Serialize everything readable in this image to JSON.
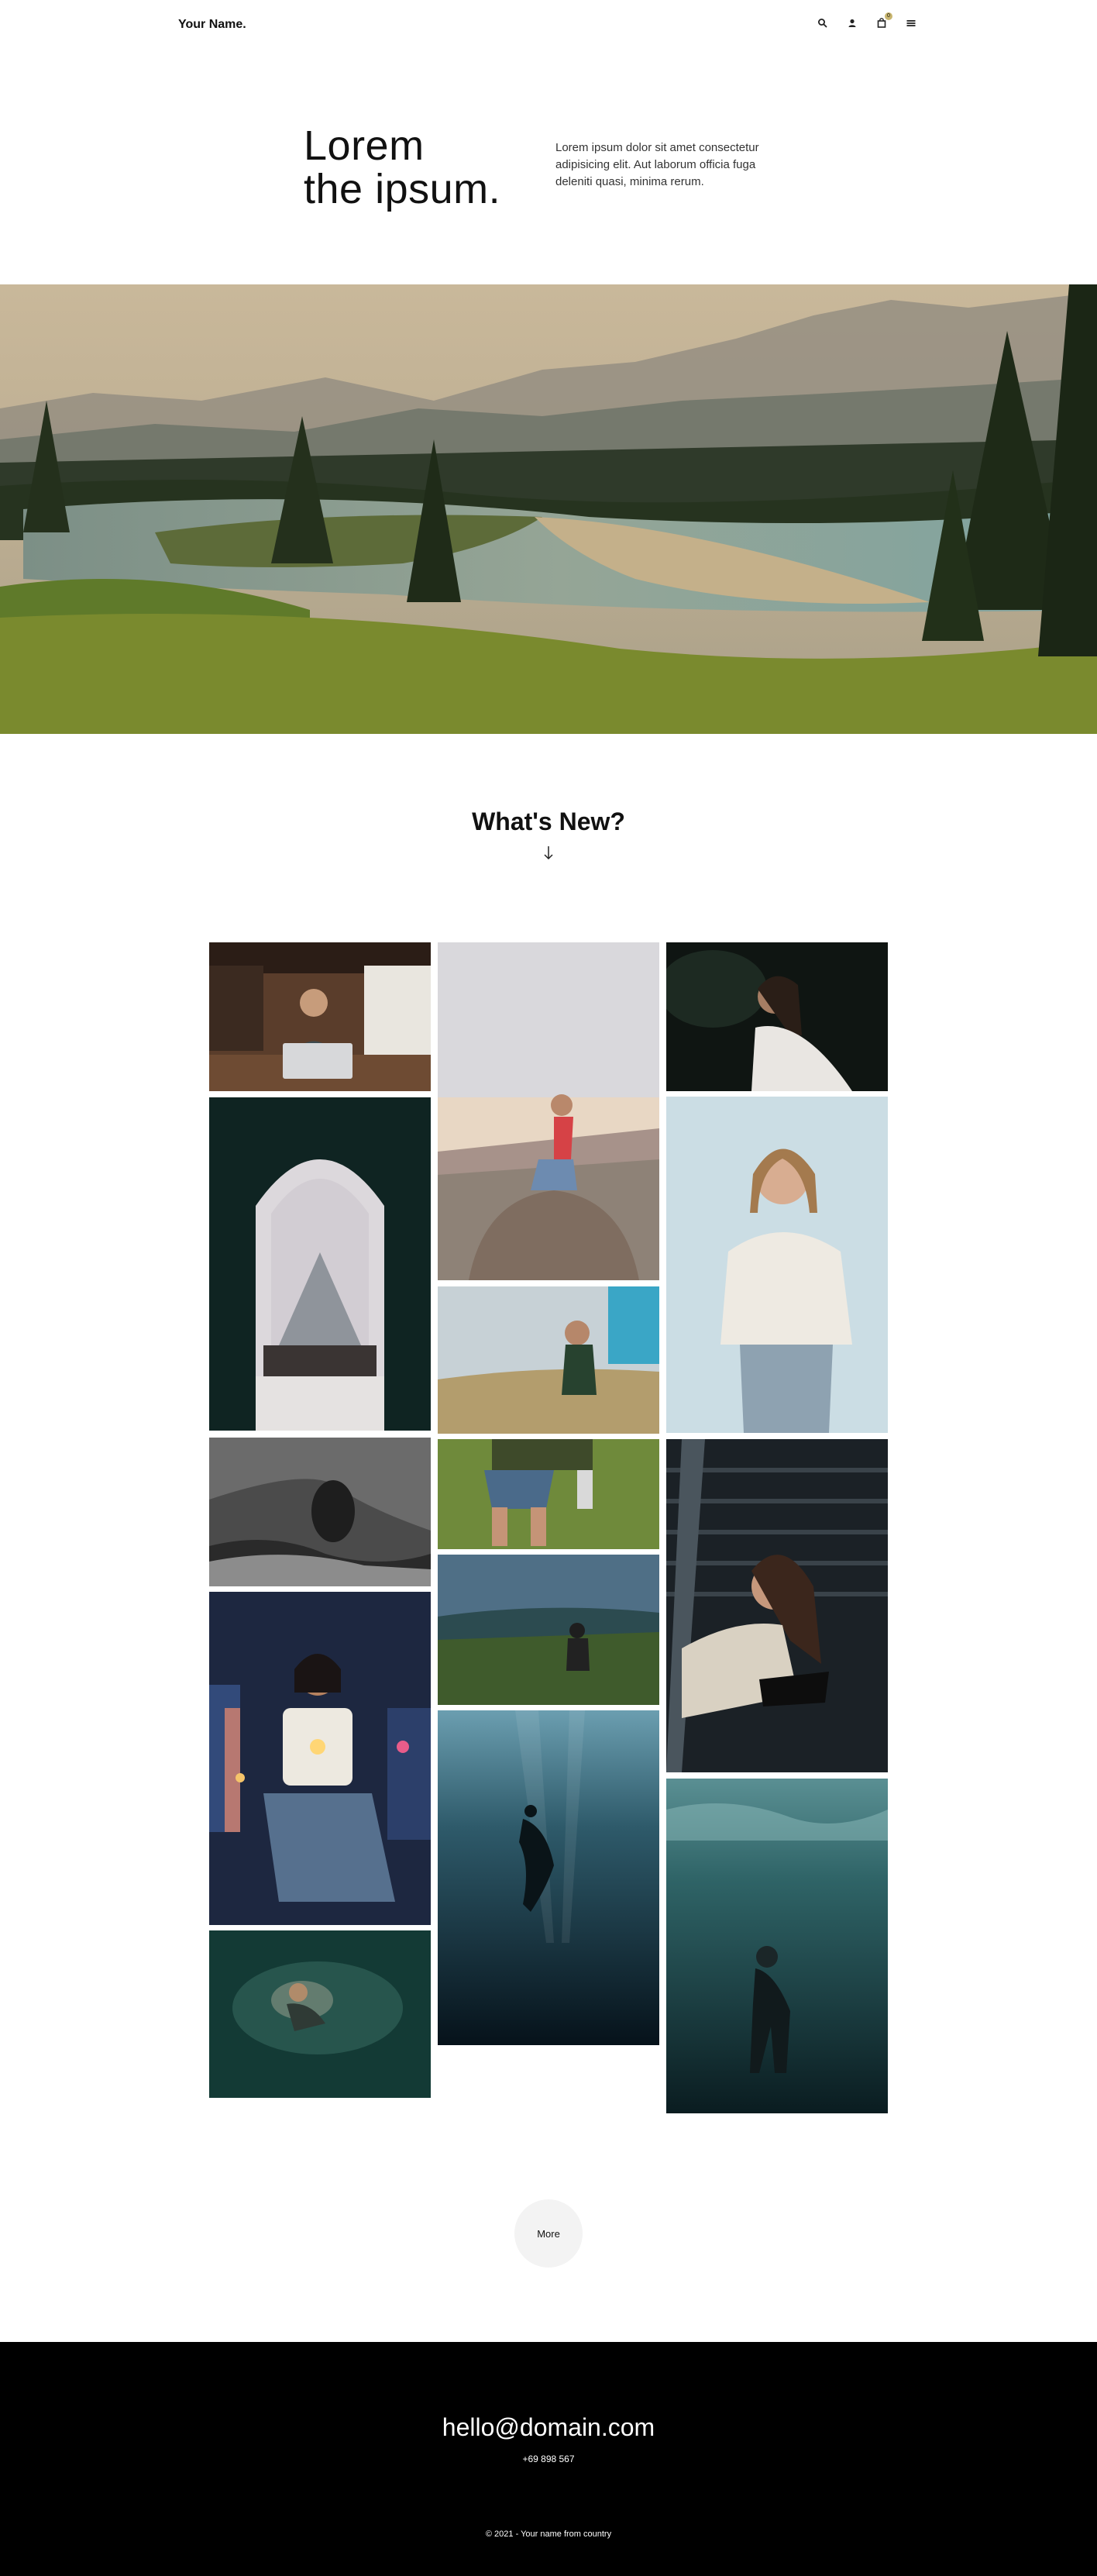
{
  "header": {
    "logo": "Your Name.",
    "icons": [
      "search-icon",
      "user-icon",
      "cart-icon",
      "menu-icon"
    ],
    "cart_count": "0"
  },
  "hero": {
    "title_line1": "Lorem",
    "title_line2": "the ipsum.",
    "description": "Lorem ipsum dolor sit amet consectetur adipisicing elit. Aut laborum officia fuga deleniti quasi, minima rerum."
  },
  "banner": {
    "subject": "mountain-lake-landscape"
  },
  "whats_new": {
    "title": "What's New?",
    "arrow_icon": "arrow-down-icon"
  },
  "gallery": [
    {
      "subject": "man-with-laptop-cafe"
    },
    {
      "subject": "woman-sitting-on-rock-sunset"
    },
    {
      "subject": "woman-dark-portrait"
    },
    {
      "subject": "louvre-pyramid-archway"
    },
    {
      "subject": "woman-with-glasses-sweater"
    },
    {
      "subject": "woman-in-wheat-field"
    },
    {
      "subject": "rock-arch-black-white"
    },
    {
      "subject": "walking-in-grass-field"
    },
    {
      "subject": "woman-on-stairs"
    },
    {
      "subject": "person-sitting-on-hill"
    },
    {
      "subject": "woman-city-lights-night"
    },
    {
      "subject": "freediver-underwater"
    },
    {
      "subject": "scuba-diver-underwater"
    },
    {
      "subject": "diver-in-green-water"
    }
  ],
  "more_button": "More",
  "footer": {
    "email": "hello@domain.com",
    "phone": "+69 898 567",
    "copyright": "© 2021 - Your name from country"
  },
  "colors": {
    "accent": "#c9b66f",
    "footer_bg": "#000000",
    "button_bg": "#f3f3f3"
  }
}
